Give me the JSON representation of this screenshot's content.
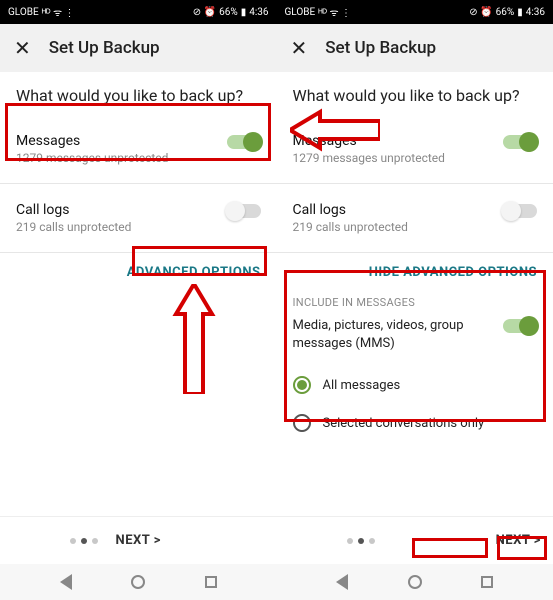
{
  "statusbar": {
    "carrier": "GLOBE",
    "battery": "66%",
    "time": "4:36"
  },
  "header": {
    "title": "Set Up Backup"
  },
  "question": "What would you like to back up?",
  "rows": {
    "messages": {
      "label": "Messages",
      "sub": "1279 messages unprotected"
    },
    "calllogs": {
      "label": "Call logs",
      "sub": "219 calls unprotected"
    }
  },
  "links": {
    "advanced": "ADVANCED OPTIONS",
    "hide_advanced": "HIDE ADVANCED OPTIONS"
  },
  "advanced_section": {
    "header": "INCLUDE IN MESSAGES",
    "media_label": "Media, pictures, videos, group messages (MMS)",
    "radio_all": "All messages",
    "radio_selected": "Selected conversations only"
  },
  "footer": {
    "next": "NEXT >"
  }
}
